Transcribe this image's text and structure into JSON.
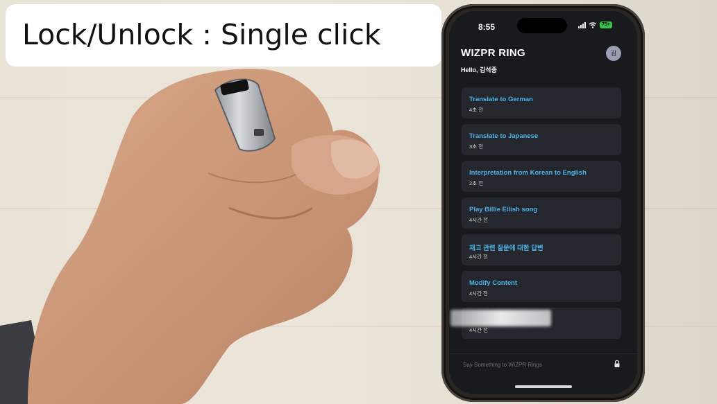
{
  "overlay_caption": "Lock/Unlock : Single click",
  "status_bar": {
    "time": "8:55",
    "battery": "75+"
  },
  "app": {
    "title": "WIZPR RING",
    "greeting": "Hello, 김석중",
    "avatar_initial": "김"
  },
  "history": [
    {
      "title": "Translate to German",
      "time": "4초 전"
    },
    {
      "title": "Translate to Japanese",
      "time": "3초 전"
    },
    {
      "title": "Interpretation from Korean to English",
      "time": "2초 전"
    },
    {
      "title": "Play Billie Eilish song",
      "time": "4시간 전"
    },
    {
      "title": "재고 관련 질문에 대한 답변",
      "time": "4시간 전"
    },
    {
      "title": "Modify Content",
      "time": "4시간 전"
    },
    {
      "title": "",
      "time": "4시간 전"
    }
  ],
  "input": {
    "placeholder": "Say Something to WIZPR Rings"
  },
  "icons": {
    "lock": "lock-icon",
    "wifi": "wifi-icon",
    "signal": "signal-icon",
    "battery": "battery-icon"
  },
  "colors": {
    "accent": "#4fb3e8",
    "screen_bg": "#181a1e",
    "card_bg": "#24272d"
  }
}
